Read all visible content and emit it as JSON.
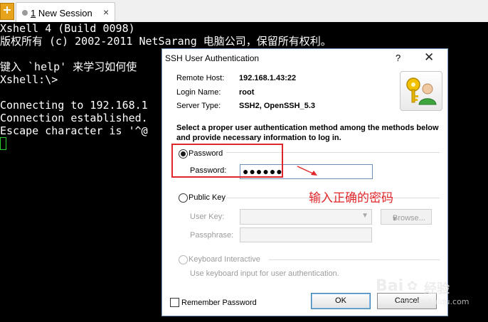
{
  "tabs": [
    {
      "number": "1",
      "label": " New Session",
      "close": "×"
    }
  ],
  "terminal": {
    "lines": [
      "Xshell 4 (Build 0098)",
      "版权所有 (c) 2002-2011 NetSarang 电脑公司，保留所有权利。",
      "",
      "键入 `help' 来学习如何使",
      "Xshell:\\>",
      "",
      "Connecting to 192.168.1",
      "Connection established.",
      "Escape character is '^@"
    ]
  },
  "dialog": {
    "title": "SSH User Authentication",
    "help_label": "?",
    "close_label": "✕",
    "info": {
      "remote_host_label": "Remote Host:",
      "remote_host": "192.168.1.43:22",
      "login_name_label": "Login Name:",
      "login_name": "root",
      "server_type_label": "Server Type:",
      "server_type": "SSH2, OpenSSH_5.3"
    },
    "instruction": "Select a proper user authentication method among the methods below and provide necessary information to log in.",
    "methods": {
      "password": {
        "label": "Password",
        "selected": true,
        "field_label": "Password:",
        "value": "●●●●●●"
      },
      "public_key": {
        "label": "Public Key",
        "selected": false,
        "user_key_label": "User Key:",
        "passphrase_label": "Passphrase:",
        "browse_label": "Browse...",
        "browse_arrow": "▾"
      },
      "keyboard_interactive": {
        "label": "Keyboard Interactive",
        "selected": false,
        "description": "Use keyboard input for user authentication."
      }
    },
    "remember_password_label": "Remember Password",
    "remember_password_checked": false,
    "ok_label": "OK",
    "cancel_label": "Cancel"
  },
  "annotation": {
    "text": "输入正确的密码",
    "color": "#e0262a"
  },
  "watermark": {
    "brand": "Bai",
    "brand_suffix": "经验",
    "url": "jingyan.baidu.com"
  },
  "colors": {
    "terminal_bg": "#000000",
    "terminal_fg": "#ffffff",
    "cursor": "#2ad12a",
    "annotation": "#e0262a"
  }
}
